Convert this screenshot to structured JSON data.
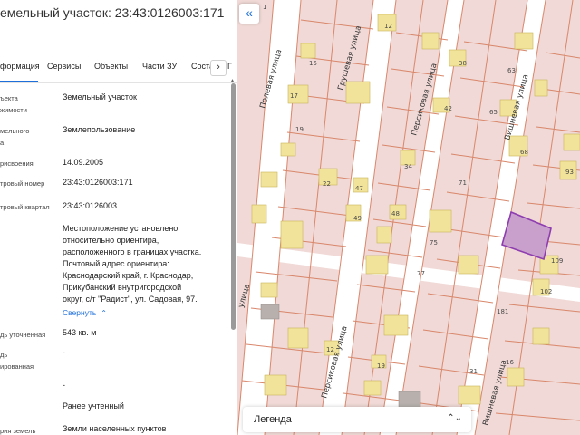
{
  "panel": {
    "title": "емельный участок: 23:43:0126003:171",
    "tabs": [
      {
        "label": "формация",
        "active": true
      },
      {
        "label": "Сервисы"
      },
      {
        "label": "Объекты"
      },
      {
        "label": "Части ЗУ"
      },
      {
        "label": "Соста"
      }
    ],
    "tabs_next_label": "›",
    "tabs_more": "Г",
    "rows": [
      {
        "label": "ъекта",
        "label2": "жимости",
        "value": "Земельный участок"
      },
      {
        "label": "мельного",
        "label2": "а",
        "value": "Землепользование"
      },
      {
        "label": "рисвоения",
        "value": "14.09.2005"
      },
      {
        "label": "тровый номер",
        "value": "23:43:0126003:171"
      },
      {
        "label": "тровый квартал",
        "value": "23:43:0126003"
      },
      {
        "label": "",
        "value": ""
      }
    ],
    "address_lines": [
      "Местоположение установлено",
      "относительно ориентира,",
      "расположенного в границах участка.",
      "Почтовый адрес ориентира:",
      "Краснодарский край, г. Краснодар,",
      "Прикубанский внутригородской",
      "округ, с/т \"Радист\", ул. Садовая, 97."
    ],
    "collapse_label": "Свернуть",
    "area_label": "дь уточненная",
    "area_value": "543 кв. м",
    "declared_label": "дь",
    "declared_label2": "ированная",
    "declared_value": "-",
    "dash_label": "",
    "dash_value": "-",
    "status_label": "",
    "status_value": "Ранее учтенный",
    "category_label": "рия земель",
    "category_value": "Земли населенных пунктов"
  },
  "map": {
    "collapse_button": "«",
    "legend_label": "Легенда",
    "legend_arrow": "⌃⌄",
    "parcel_fill": "#f0d9d6",
    "line_color": "#d9876b",
    "building_color": "#f2e39a",
    "selected_color": "#8e3db0",
    "streets": [
      {
        "name": "Грушевая улица"
      },
      {
        "name": "Полевая улица"
      },
      {
        "name": "Персиковая улица"
      },
      {
        "name": "Вишневая улица"
      },
      {
        "name": "улица"
      },
      {
        "name": "Персиковая улица"
      },
      {
        "name": "Вишневая улица"
      }
    ],
    "numbers": [
      "12",
      "15",
      "38",
      "63",
      "17",
      "42",
      "65",
      "19",
      "68",
      "22",
      "47",
      "71",
      "93",
      "34",
      "49",
      "48",
      "75",
      "109",
      "77",
      "102",
      "12",
      "181",
      "19",
      "31",
      "16",
      "1"
    ]
  }
}
